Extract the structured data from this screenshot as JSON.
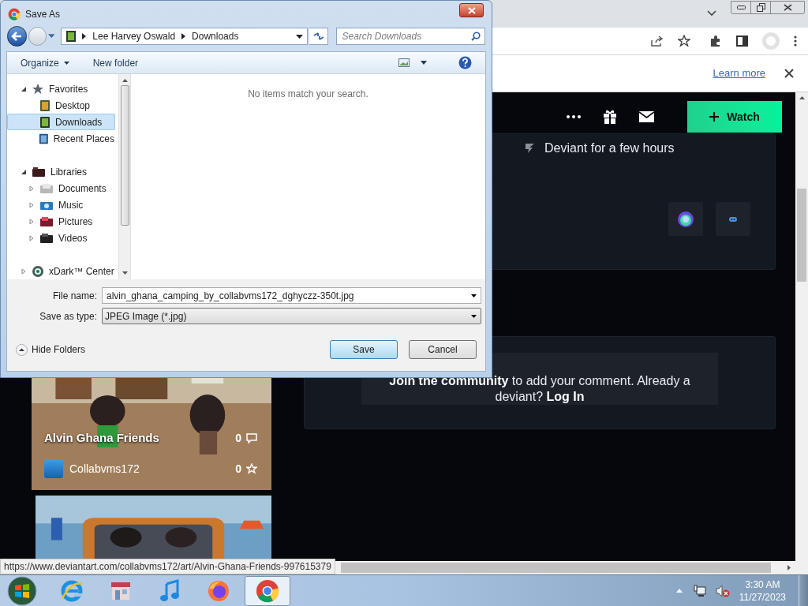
{
  "dialog": {
    "title": "Save As",
    "path": [
      "Lee Harvey Oswald",
      "Downloads"
    ],
    "search": {
      "placeholder": "Search Downloads"
    },
    "toolbar": [
      "Organize",
      "New folder"
    ],
    "tree": [
      {
        "label": "Favorites",
        "kind": "favorites",
        "expanded": true,
        "selected": false,
        "children": [
          {
            "label": "Desktop",
            "kind": "desktop",
            "selected": false
          },
          {
            "label": "Downloads",
            "kind": "downloads",
            "selected": true
          },
          {
            "label": "Recent Places",
            "kind": "recent",
            "selected": false
          }
        ]
      },
      {
        "label": "Libraries",
        "kind": "libraries",
        "expanded": true,
        "selected": false,
        "children": [
          {
            "label": "Documents",
            "kind": "documents",
            "expanded": false,
            "selected": false
          },
          {
            "label": "Music",
            "kind": "music",
            "expanded": false,
            "selected": false
          },
          {
            "label": "Pictures",
            "kind": "pictures",
            "expanded": false,
            "selected": false
          },
          {
            "label": "Videos",
            "kind": "videos",
            "expanded": false,
            "selected": false
          }
        ]
      },
      {
        "label": "xDark™ Center",
        "kind": "center",
        "expanded": false,
        "selected": false
      }
    ],
    "empty_message": "No items match your search.",
    "file_name": {
      "label": "File name:",
      "value": "alvin_ghana_camping_by_collabvms172_dghyczz-350t.jpg"
    },
    "save_type": {
      "label": "Save as type:",
      "value": "JPEG Image (*.jpg)"
    },
    "hide_folders": "Hide Folders",
    "buttons": [
      {
        "label": "Save",
        "default": true
      },
      {
        "label": "Cancel",
        "default": false
      }
    ]
  },
  "browser": {
    "info_bar": {
      "link": "Learn more"
    },
    "header": {
      "watch": "Watch"
    },
    "profile": {
      "membership": "Deviant for a few hours"
    },
    "comment": {
      "join": "Join the community",
      "text": " to add your comment. Already a deviant? ",
      "login": "Log In"
    },
    "thumbnails": [
      {
        "kind": "card",
        "title": "Alvin Ghana Friends",
        "comments": "0",
        "favourites": "0",
        "author": "Collabvms172"
      },
      {
        "kind": "picture"
      }
    ],
    "status_url": "https://www.deviantart.com/collabvms172/art/Alvin-Ghana-Friends-997615379"
  },
  "taskbar": {
    "apps": [
      {
        "kind": "start",
        "selected": false
      },
      {
        "kind": "ie",
        "selected": false
      },
      {
        "kind": "store",
        "selected": false
      },
      {
        "kind": "music",
        "selected": false
      },
      {
        "kind": "firefox",
        "selected": false
      },
      {
        "kind": "chrome",
        "selected": true
      }
    ],
    "time": "3:30 AM",
    "date": "11/27/2023"
  }
}
